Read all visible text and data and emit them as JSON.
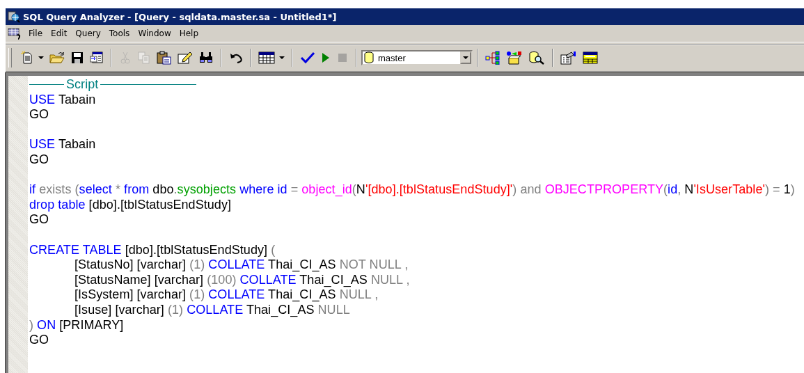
{
  "window": {
    "title": "SQL Query Analyzer - [Query - sqldata.master.sa - Untitled1*]"
  },
  "menu": [
    "File",
    "Edit",
    "Query",
    "Tools",
    "Window",
    "Help"
  ],
  "toolbar": {
    "groups": [
      {
        "buttons": [
          {
            "kind": "dropdown",
            "disabled": false
          },
          {
            "kind": "button",
            "disabled": false
          },
          {
            "kind": "button",
            "disabled": false
          },
          {
            "kind": "button",
            "disabled": false
          }
        ]
      },
      {
        "buttons": [
          {
            "kind": "button",
            "disabled": true
          },
          {
            "kind": "button",
            "disabled": true
          },
          {
            "kind": "button",
            "disabled": false
          },
          {
            "kind": "button",
            "disabled": false
          },
          {
            "kind": "button",
            "disabled": false
          }
        ]
      },
      {
        "buttons": [
          {
            "kind": "button",
            "disabled": false
          }
        ]
      },
      {
        "buttons": [
          {
            "kind": "dropdown",
            "disabled": false
          }
        ]
      },
      {
        "buttons": [
          {
            "kind": "button",
            "disabled": false
          },
          {
            "kind": "button",
            "disabled": false
          },
          {
            "kind": "button",
            "disabled": true
          }
        ]
      },
      {
        "buttons": [
          {
            "kind": "combo",
            "value": "master"
          }
        ]
      },
      {
        "buttons": [
          {
            "kind": "button",
            "disabled": false
          },
          {
            "kind": "button",
            "disabled": false
          },
          {
            "kind": "button",
            "disabled": false
          }
        ]
      },
      {
        "buttons": [
          {
            "kind": "button",
            "disabled": false
          },
          {
            "kind": "button",
            "disabled": false
          }
        ]
      }
    ]
  },
  "editor": {
    "header": "Script",
    "blocks": [
      [
        [
          {
            "kind": "keyword",
            "text": "USE"
          },
          {
            "kind": "identifier",
            "text": " Tabain"
          }
        ],
        [
          {
            "kind": "identifier",
            "text": "GO"
          }
        ]
      ],
      [
        [
          {
            "kind": "keyword",
            "text": "USE"
          },
          {
            "kind": "identifier",
            "text": " Tabain"
          }
        ],
        [
          {
            "kind": "identifier",
            "text": "GO"
          }
        ]
      ],
      [
        [
          {
            "kind": "keyword",
            "text": "if"
          },
          {
            "kind": "operator",
            "text": " exists ("
          },
          {
            "kind": "keyword",
            "text": "select"
          },
          {
            "kind": "operator",
            "text": " * "
          },
          {
            "kind": "keyword",
            "text": "from"
          },
          {
            "kind": "identifier",
            "text": " dbo"
          },
          {
            "kind": "operator",
            "text": "."
          },
          {
            "kind": "system",
            "text": "sysobjects"
          },
          {
            "kind": "keyword",
            "text": " where id"
          },
          {
            "kind": "operator",
            "text": " = "
          },
          {
            "kind": "function",
            "text": "object_id"
          },
          {
            "kind": "operator",
            "text": "("
          },
          {
            "kind": "identifier",
            "text": "N"
          },
          {
            "kind": "string",
            "text": "'[dbo].[tblStatusEndStudy]'"
          },
          {
            "kind": "operator",
            "text": ") and "
          },
          {
            "kind": "function",
            "text": "OBJECTPROPERTY"
          },
          {
            "kind": "operator",
            "text": "("
          },
          {
            "kind": "keyword",
            "text": "id"
          },
          {
            "kind": "operator",
            "text": ", "
          },
          {
            "kind": "identifier",
            "text": "N"
          },
          {
            "kind": "string",
            "text": "'IsUserTable'"
          },
          {
            "kind": "operator",
            "text": ") = "
          },
          {
            "kind": "identifier",
            "text": "1"
          },
          {
            "kind": "operator",
            "text": ")"
          }
        ],
        [
          {
            "kind": "keyword",
            "text": "drop table"
          },
          {
            "kind": "identifier",
            "text": " [dbo].[tblStatusEndStudy]"
          }
        ],
        [
          {
            "kind": "identifier",
            "text": "GO"
          }
        ]
      ],
      [
        [
          {
            "kind": "keyword",
            "text": "CREATE TABLE"
          },
          {
            "kind": "identifier",
            "text": " [dbo].[tblStatusEndStudy]"
          },
          {
            "kind": "operator",
            "text": " ("
          }
        ],
        [
          {
            "kind": "identifier",
            "text": "\t[StatusNo] [varchar]"
          },
          {
            "kind": "operator",
            "text": " (1) "
          },
          {
            "kind": "keyword",
            "text": "COLLATE"
          },
          {
            "kind": "identifier",
            "text": " Thai_CI_AS"
          },
          {
            "kind": "operator",
            "text": " NOT NULL ,"
          }
        ],
        [
          {
            "kind": "identifier",
            "text": "\t[StatusName] [varchar]"
          },
          {
            "kind": "operator",
            "text": " (100) "
          },
          {
            "kind": "keyword",
            "text": "COLLATE"
          },
          {
            "kind": "identifier",
            "text": " Thai_CI_AS"
          },
          {
            "kind": "operator",
            "text": " NULL ,"
          }
        ],
        [
          {
            "kind": "identifier",
            "text": "\t[IsSystem] [varchar]"
          },
          {
            "kind": "operator",
            "text": " (1) "
          },
          {
            "kind": "keyword",
            "text": "COLLATE"
          },
          {
            "kind": "identifier",
            "text": " Thai_CI_AS"
          },
          {
            "kind": "operator",
            "text": " NULL ,"
          }
        ],
        [
          {
            "kind": "identifier",
            "text": "\t[Isuse] [varchar]"
          },
          {
            "kind": "operator",
            "text": " (1) "
          },
          {
            "kind": "keyword",
            "text": "COLLATE"
          },
          {
            "kind": "identifier",
            "text": " Thai_CI_AS"
          },
          {
            "kind": "operator",
            "text": " NULL"
          }
        ],
        [
          {
            "kind": "operator",
            "text": ")"
          },
          {
            "kind": "keyword",
            "text": " ON"
          },
          {
            "kind": "identifier",
            "text": " [PRIMARY]"
          }
        ],
        [
          {
            "kind": "identifier",
            "text": "GO"
          }
        ]
      ]
    ]
  }
}
